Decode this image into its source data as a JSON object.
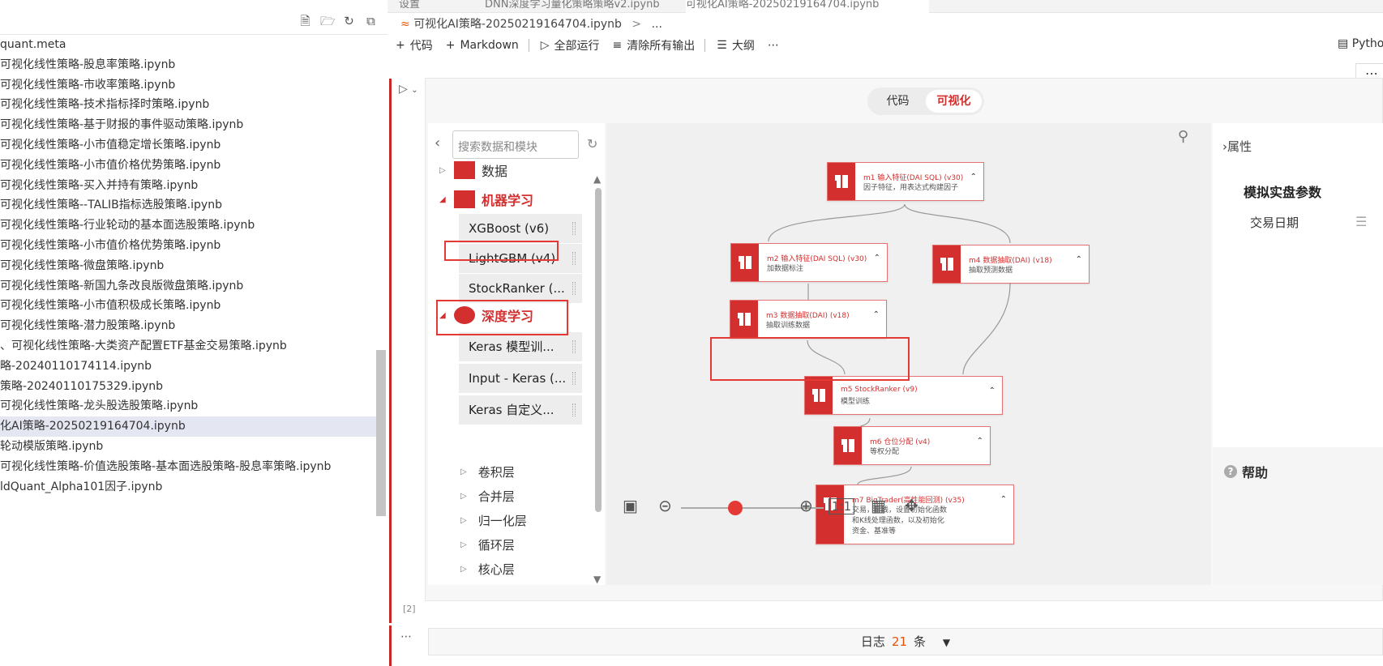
{
  "explorer": {
    "files": [
      "quant.meta",
      "可视化线性策略-股息率策略.ipynb",
      "可视化线性策略-市收率策略.ipynb",
      "可视化线性策略-技术指标择时策略.ipynb",
      "可视化线性策略-基于财报的事件驱动策略.ipynb",
      "可视化线性策略-小市值稳定增长策略.ipynb",
      "可视化线性策略-小市值价格优势策略.ipynb",
      "可视化线性策略-买入并持有策略.ipynb",
      "可视化线性策略--TALIB指标选股策略.ipynb",
      " 可视化线性策略-行业轮动的基本面选股策略.ipynb",
      " 可视化线性策略-小市值价格优势策略.ipynb",
      " 可视化线性策略-微盘策略.ipynb",
      " 可视化线性策略-新国九条改良版微盘策略.ipynb",
      " 可视化线性策略-小市值积极成长策略.ipynb",
      " 可视化线性策略-潜力股策略.ipynb",
      "、可视化线性策略-大类资产配置ETF基金交易策略.ipynb",
      "略-20240110174114.ipynb",
      "策略-20240110175329.ipynb",
      " 可视化线性策略-龙头股选股策略.ipynb",
      "化AI策略-20250219164704.ipynb",
      "轮动模版策略.ipynb",
      " 可视化线性策略-价值选股策略-基本面选股策略-股息率策略.ipynb",
      "ldQuant_Alpha101因子.ipynb"
    ],
    "selected_index": 19
  },
  "tabs": [
    "设置",
    "DNN深度学习量化策略策略v2.ipynb",
    "可视化AI策略-20250219164704.ipynb"
  ],
  "breadcrumb": {
    "file": "可视化AI策略-20250219164704.ipynb",
    "sep": ">",
    "rest": "..."
  },
  "toolbar": {
    "code": "代码",
    "markdown": "Markdown",
    "run_all": "全部运行",
    "clear_outputs": "清除所有输出",
    "outline": "大纲",
    "more": "⋯",
    "kernel": "Pytho"
  },
  "cell": {
    "exec_count": "[2]",
    "more": "⋯"
  },
  "mode_toggle": {
    "code": "代码",
    "visual": "可视化"
  },
  "module_panel": {
    "search_placeholder": "搜索数据和模块",
    "categories": {
      "data": "数据",
      "ml": "机器学习",
      "dl": "深度学习"
    },
    "ml_modules": [
      "XGBoost (v6)",
      "LightGBM (v4)",
      "StockRanker (..."
    ],
    "dl_modules": [
      "Keras 模型训...",
      "Input - Keras (...",
      "Keras 自定义..."
    ],
    "dl_subcategories": [
      "卷积层",
      "合并层",
      "归一化层",
      "循环层",
      "核心层"
    ]
  },
  "canvas": {
    "nodes": [
      {
        "id": "m1",
        "title": "m1 输入特征(DAI SQL) (v30)",
        "sub": "因子特征，用表达式构建因子"
      },
      {
        "id": "m2",
        "title": "m2 输入特征(DAI SQL) (v30)",
        "sub": "加数据标注"
      },
      {
        "id": "m4",
        "title": "m4 数据抽取(DAI) (v18)",
        "sub": "抽取预测数据"
      },
      {
        "id": "m3",
        "title": "m3 数据抽取(DAI) (v18)",
        "sub": "抽取训练数据"
      },
      {
        "id": "m5",
        "title": "m5 StockRanker (v9)",
        "sub": "模型训练"
      },
      {
        "id": "m6",
        "title": "m6 仓位分配 (v4)",
        "sub": "等权分配"
      },
      {
        "id": "m7",
        "title": "m7 BigTrader(高性能回测) (v35)",
        "sub": "交易，日线，设置初始化函数",
        "sub2": "和K线处理函数，以及初始化",
        "sub3": "资金、基准等"
      }
    ],
    "zoom": {
      "fit": "1:1",
      "zoom_level": 0.33
    }
  },
  "properties": {
    "title": "属性",
    "section": "模拟实盘参数",
    "field": "交易日期",
    "help": "帮助"
  },
  "log": {
    "label": "日志",
    "count": "21",
    "unit": "条"
  },
  "colors": {
    "accent": "#d32f2f",
    "highlight_box": "#e53935"
  }
}
